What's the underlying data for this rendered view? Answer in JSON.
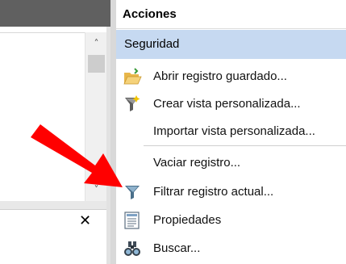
{
  "actions_pane": {
    "title": "Acciones",
    "section": "Seguridad",
    "items": [
      {
        "label": "Abrir registro guardado...",
        "icon": "folder-open-icon"
      },
      {
        "label": "Crear vista personalizada...",
        "icon": "filter-create-icon"
      },
      {
        "label": "Importar vista personalizada...",
        "icon": ""
      },
      {
        "label": "Vaciar registro...",
        "icon": ""
      },
      {
        "label": "Filtrar registro actual...",
        "icon": "filter-icon"
      },
      {
        "label": "Propiedades",
        "icon": "properties-icon"
      },
      {
        "label": "Buscar...",
        "icon": "binoculars-icon"
      }
    ]
  },
  "left_pane": {
    "scroll_up": "˄",
    "scroll_down": "˅",
    "close": "✕"
  },
  "colors": {
    "section_bg": "#c6d9f1",
    "arrow": "#ff0000"
  }
}
